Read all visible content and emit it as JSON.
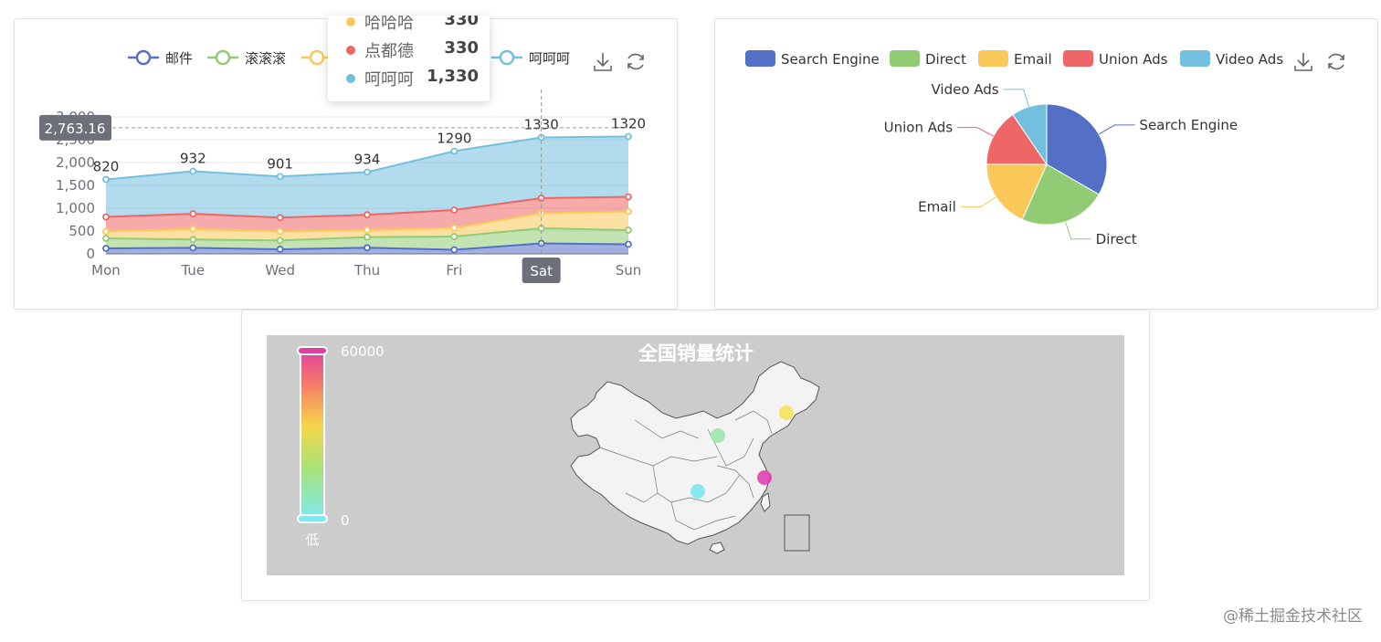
{
  "chart_data": [
    {
      "type": "area",
      "stacked": true,
      "categories": [
        "Mon",
        "Tue",
        "Wed",
        "Thu",
        "Fri",
        "Sat",
        "Sun"
      ],
      "series": [
        {
          "name": "邮件",
          "color": "#5470c6",
          "values": [
            120,
            132,
            101,
            134,
            90,
            230,
            210
          ]
        },
        {
          "name": "滚滚滚",
          "color": "#91cc75",
          "values": [
            220,
            182,
            191,
            234,
            290,
            330,
            310
          ]
        },
        {
          "name": "",
          "color": "#fac858",
          "values": [
            150,
            232,
            201,
            154,
            190,
            330,
            410
          ]
        },
        {
          "name": "点都德",
          "color": "#ee6666",
          "values": [
            320,
            332,
            301,
            334,
            390,
            330,
            320
          ]
        },
        {
          "name": "呵呵呵",
          "color": "#73c0de",
          "values": [
            820,
            932,
            901,
            934,
            1290,
            1330,
            1320
          ]
        }
      ],
      "top_labels": [
        "820",
        "932",
        "901",
        "934",
        "1290",
        "1330",
        "1320"
      ],
      "yticks": [
        "0",
        "500",
        "1,000",
        "1,500",
        "2,000",
        "2,500",
        "3,000"
      ],
      "ylim": [
        0,
        3000
      ],
      "grid": true,
      "legend": "top-center",
      "axis_pointer": {
        "value": "2,763.16",
        "category": "Sat"
      },
      "tooltip": {
        "rows": [
          {
            "name": "哈哈哈",
            "value": "330",
            "color": "#fac858"
          },
          {
            "name": "点都德",
            "value": "330",
            "color": "#ee6666"
          },
          {
            "name": "呵呵呵",
            "value": "1,330",
            "color": "#73c0de"
          }
        ]
      }
    },
    {
      "type": "pie",
      "legend": "top",
      "slices": [
        {
          "name": "Search Engine",
          "value": 1048,
          "color": "#5470c6"
        },
        {
          "name": "Direct",
          "value": 735,
          "color": "#91cc75"
        },
        {
          "name": "Email",
          "value": 580,
          "color": "#fac858"
        },
        {
          "name": "Union Ads",
          "value": 484,
          "color": "#ee6666"
        },
        {
          "name": "Video Ads",
          "value": 300,
          "color": "#73c0de"
        }
      ]
    },
    {
      "type": "map",
      "title": "全国销量统计",
      "visual_map": {
        "max": "60000",
        "min": "0",
        "low_label": "低"
      },
      "background": "#cccccc",
      "points": [
        {
          "color": "#f5e35a"
        },
        {
          "color": "#9fe6b0"
        },
        {
          "color": "#e040b0"
        },
        {
          "color": "#7ee8f0"
        }
      ]
    }
  ],
  "toolbox": {
    "icons": [
      "download-icon",
      "refresh-icon"
    ]
  },
  "watermark": "@稀土掘金技术社区"
}
